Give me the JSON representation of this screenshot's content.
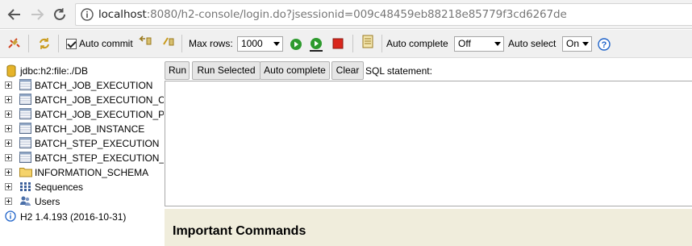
{
  "browser": {
    "url_host": "localhost",
    "url_rest": ":8080/h2-console/login.do?jsessionid=009c48459eb88218e85779f3cd6267de",
    "icons": [
      "back-arrow-icon",
      "forward-arrow-icon",
      "reload-icon",
      "info-icon"
    ]
  },
  "toolbar": {
    "auto_commit_label": "Auto commit",
    "auto_commit_checked": true,
    "max_rows_label": "Max rows:",
    "max_rows_value": "1000",
    "auto_complete_label": "Auto complete",
    "auto_complete_value": "Off",
    "auto_select_label": "Auto select",
    "auto_select_value": "On",
    "help_icon_text": "?"
  },
  "tree": {
    "root": "jdbc:h2:file:./DB",
    "items": [
      {
        "label": "BATCH_JOB_EXECUTION",
        "icon": "table-icon"
      },
      {
        "label": "BATCH_JOB_EXECUTION_C",
        "icon": "table-icon"
      },
      {
        "label": "BATCH_JOB_EXECUTION_P",
        "icon": "table-icon"
      },
      {
        "label": "BATCH_JOB_INSTANCE",
        "icon": "table-icon"
      },
      {
        "label": "BATCH_STEP_EXECUTION",
        "icon": "table-icon"
      },
      {
        "label": "BATCH_STEP_EXECUTION_",
        "icon": "table-icon"
      },
      {
        "label": "INFORMATION_SCHEMA",
        "icon": "folder-icon"
      },
      {
        "label": "Sequences",
        "icon": "sequences-icon"
      },
      {
        "label": "Users",
        "icon": "users-icon"
      }
    ],
    "version": "H2 1.4.193 (2016-10-31)"
  },
  "query": {
    "run_label": "Run",
    "run_selected_label": "Run Selected",
    "auto_complete_label": "Auto complete",
    "clear_label": "Clear",
    "sql_label": "SQL statement:"
  },
  "bottom": {
    "heading": "Important Commands"
  },
  "colors": {
    "toolbar_bg": "#f0f0f0",
    "bottom_bg": "#f0eddc",
    "run_green": "#2d9a2d",
    "stop_red": "#d9261c",
    "help_blue": "#1f63c9"
  }
}
